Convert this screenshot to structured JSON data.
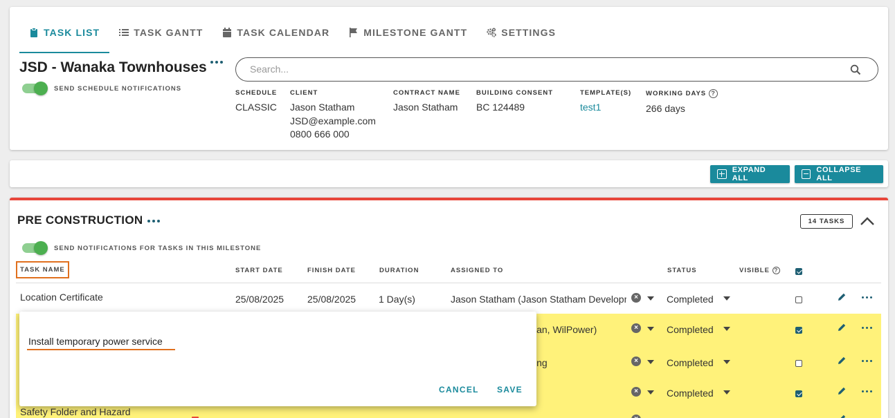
{
  "tabs": [
    {
      "label": "TASK LIST",
      "icon": "clipboard-icon",
      "active": true
    },
    {
      "label": "TASK GANTT",
      "icon": "list-icon"
    },
    {
      "label": "TASK CALENDAR",
      "icon": "calendar-icon"
    },
    {
      "label": "MILESTONE GANTT",
      "icon": "flag-icon"
    },
    {
      "label": "SETTINGS",
      "icon": "cogs-icon"
    }
  ],
  "project": {
    "title": "JSD - Wanaka Townhouses",
    "notify_label": "SEND SCHEDULE NOTIFICATIONS",
    "notify_on": true
  },
  "search": {
    "placeholder": "Search..."
  },
  "info": {
    "schedule": {
      "label": "SCHEDULE",
      "value": "CLASSIC"
    },
    "client": {
      "label": "CLIENT",
      "name": "Jason Statham",
      "email": "JSD@example.com",
      "phone": "0800 666 000"
    },
    "contract": {
      "label": "CONTRACT NAME",
      "value": "Jason Statham"
    },
    "consent": {
      "label": "BUILDING CONSENT",
      "value": "BC 124489"
    },
    "templates": {
      "label": "TEMPLATE(S)",
      "value": "test1"
    },
    "working_days": {
      "label": "WORKING DAYS",
      "value": "266 days",
      "help": "?"
    }
  },
  "toolbar": {
    "expand_label": "EXPAND ALL",
    "collapse_label": "COLLAPSE ALL"
  },
  "milestone": {
    "title": "PRE CONSTRUCTION",
    "task_count": "14 TASKS",
    "notify_label": "SEND NOTIFICATIONS FOR TASKS IN THIS MILESTONE",
    "accent_color": "#e8473b",
    "columns": {
      "task_name": "TASK NAME",
      "start_date": "START DATE",
      "finish_date": "FINISH DATE",
      "duration": "DURATION",
      "assigned_to": "ASSIGNED TO",
      "status": "STATUS",
      "visible": "VISIBLE"
    },
    "rows": [
      {
        "name": "Location Certificate",
        "start": "25/08/2025",
        "finish": "25/08/2025",
        "duration": "1 Day(s)",
        "assigned": "Jason Statham (Jason Statham Developments)",
        "status": "Completed",
        "visible": false,
        "highlight": false
      },
      {
        "name": "",
        "start": "",
        "finish": "",
        "duration": "",
        "assigned": "ian, WilPower)",
        "status": "Completed",
        "visible": true,
        "highlight": true
      },
      {
        "name": "",
        "start": "",
        "finish": "",
        "duration": "",
        "assigned": "ing",
        "status": "Completed",
        "visible": false,
        "highlight": true
      },
      {
        "name": "",
        "start": "",
        "finish": "",
        "duration": "",
        "assigned": "",
        "status": "Completed",
        "visible": true,
        "highlight": true
      },
      {
        "name": "Safety Folder and Hazard",
        "start": "",
        "finish": "",
        "duration": "",
        "assigned": "",
        "status": "",
        "visible": false,
        "highlight": true
      }
    ]
  },
  "popup": {
    "value": "Install temporary power service",
    "cancel_label": "CANCEL",
    "save_label": "SAVE"
  },
  "colors": {
    "teal": "#1a8a9c",
    "navy": "#1f5f73",
    "highlight": "#fff27a",
    "orange": "#e0701e",
    "toggle_green": "#4caf50"
  }
}
